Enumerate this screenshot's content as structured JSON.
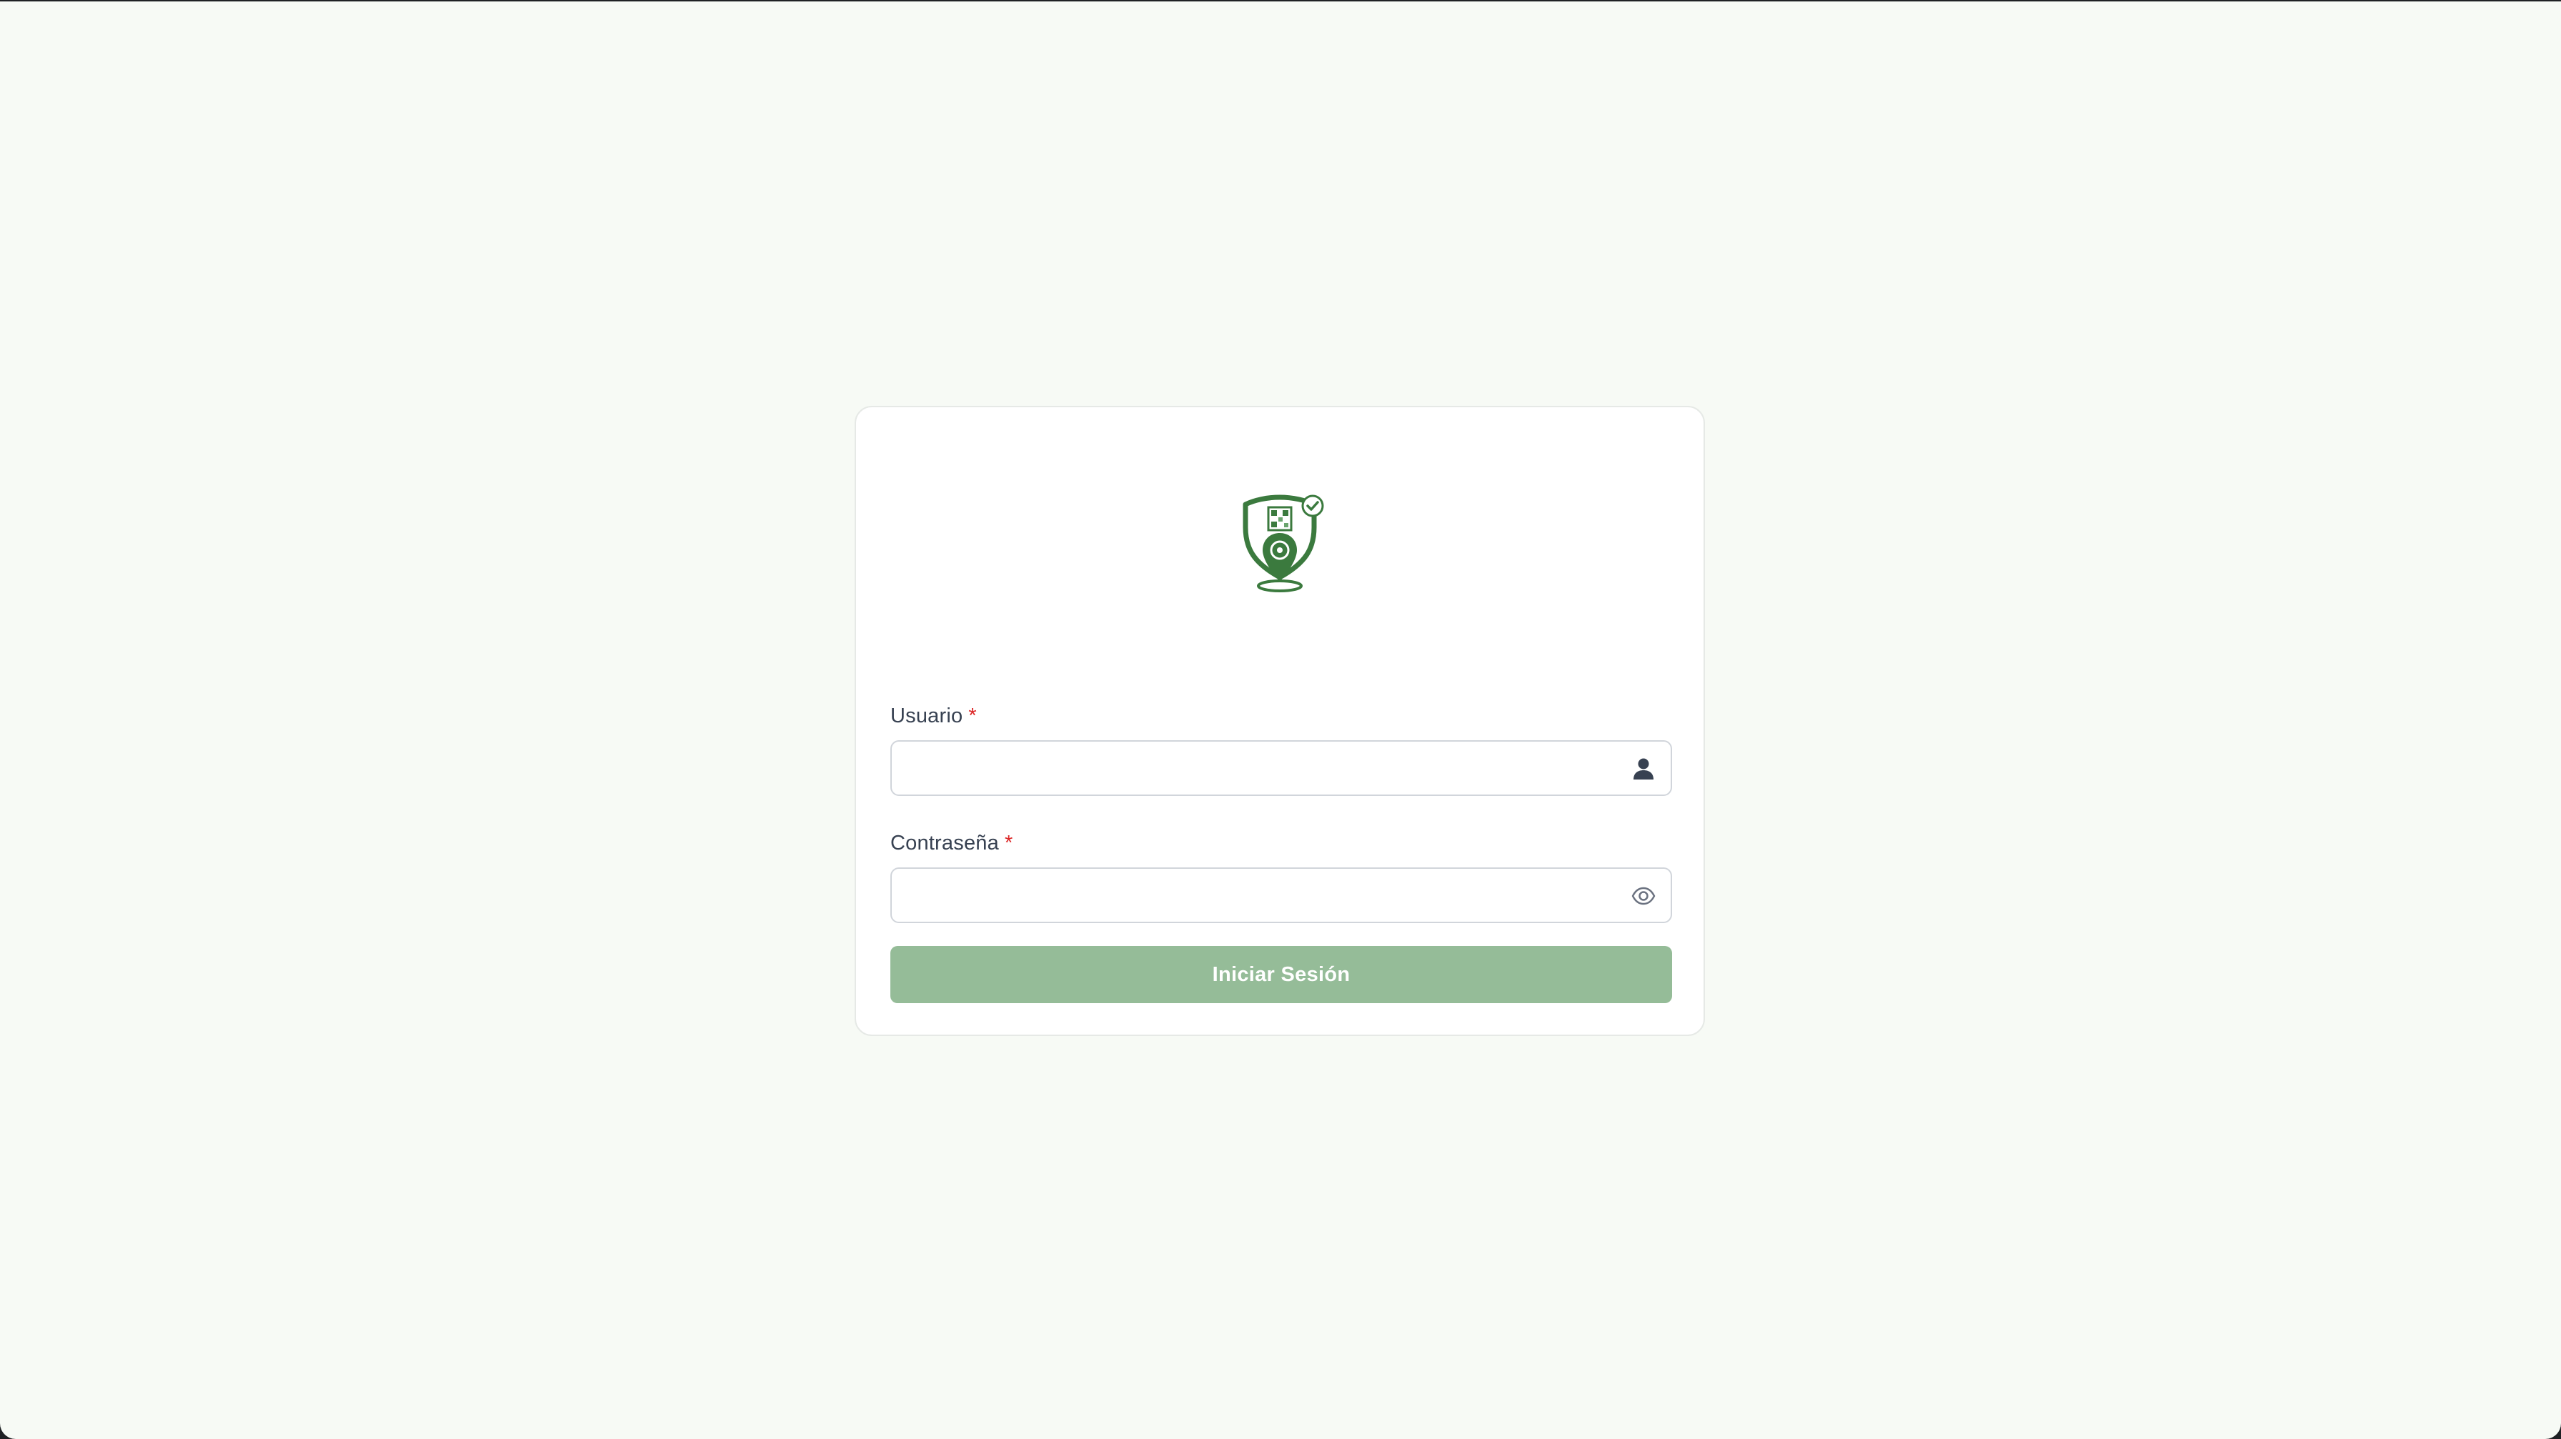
{
  "login": {
    "logo_icon": "shield-map-pin-qr-logo",
    "username": {
      "label": "Usuario",
      "required_mark": "*",
      "value": "",
      "icon": "user-icon"
    },
    "password": {
      "label": "Contraseña",
      "required_mark": "*",
      "value": "",
      "icon": "eye-icon"
    },
    "submit_label": "Iniciar Sesión"
  },
  "colors": {
    "background": "#f7faf5",
    "card": "#ffffff",
    "brand_green": "#3b7a3e",
    "button": "#95bc98",
    "required": "#dc2626"
  }
}
